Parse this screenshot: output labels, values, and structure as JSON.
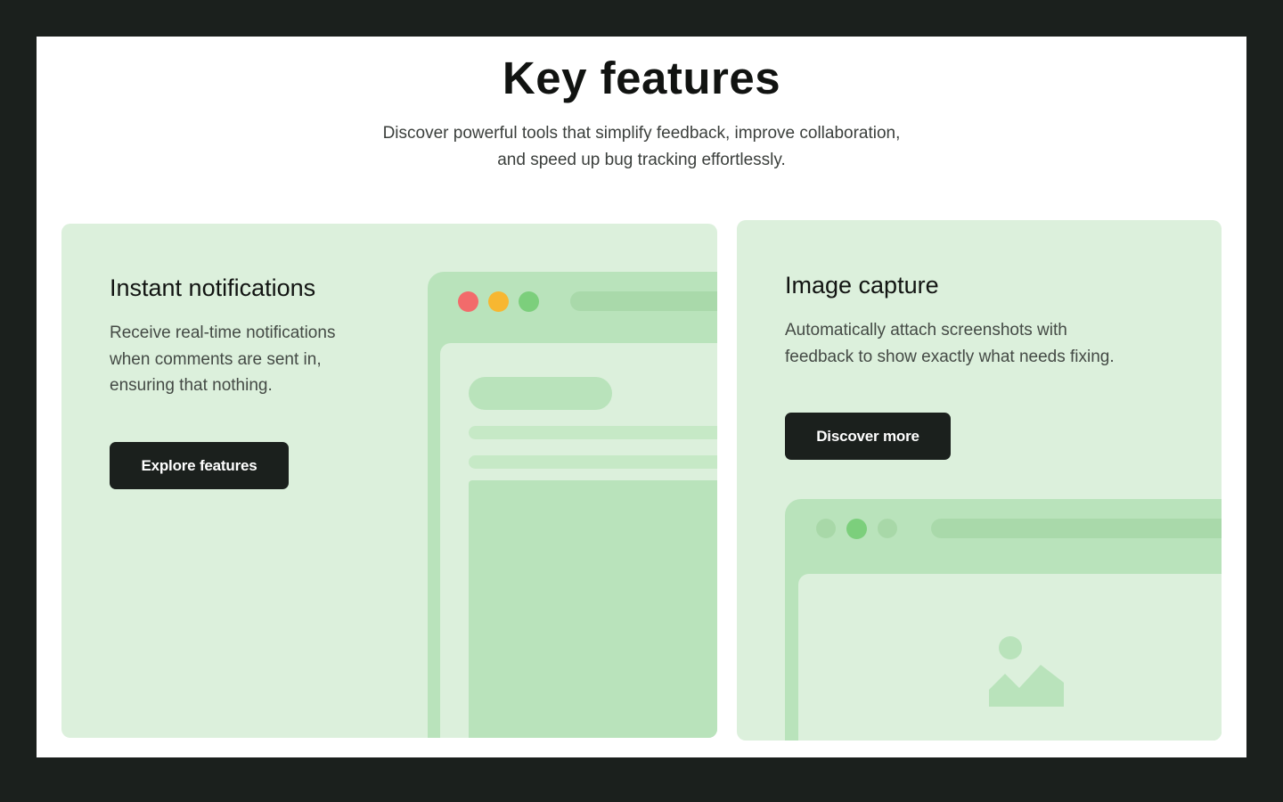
{
  "section": {
    "title": "Key features",
    "subtitle_line1": "Discover powerful tools that simplify feedback, improve collaboration,",
    "subtitle_line2": "and speed up bug tracking effortlessly."
  },
  "cards": [
    {
      "title": "Instant notifications",
      "text_line1": "Receive real-time notifications",
      "text_line2": "when comments are sent in,",
      "text_line3": "ensuring that nothing.",
      "button_label": "Explore features",
      "window_dots": [
        "#f26b6b",
        "#f7b731",
        "#7ccf7c"
      ],
      "illustration_icon": "browser-window-icon"
    },
    {
      "title": "Image capture",
      "text_line1": "Automatically attach screenshots with",
      "text_line2": "feedback to show exactly what needs fixing.",
      "button_label": "Discover more",
      "window_dots": [
        "#a8d8a8",
        "#7ccf7c",
        "#a8d8a8"
      ],
      "illustration_icon": "image-placeholder-icon"
    }
  ],
  "colors": {
    "frame_background": "#1b201d",
    "page_background": "#ffffff",
    "card_background": "#dcf0dc",
    "mock_light": "#b9e3bb",
    "mock_dark": "#a8d8a8",
    "button_background": "#1b201d",
    "button_text": "#ffffff"
  }
}
